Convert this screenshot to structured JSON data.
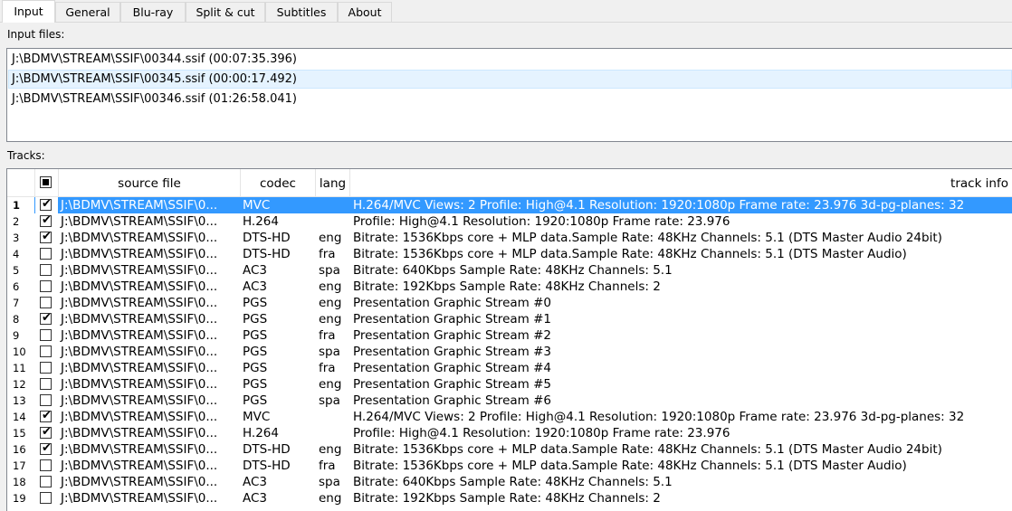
{
  "tabs": [
    {
      "label": "Input",
      "active": true
    },
    {
      "label": "General",
      "active": false
    },
    {
      "label": "Blu-ray",
      "active": false
    },
    {
      "label": "Split & cut",
      "active": false
    },
    {
      "label": "Subtitles",
      "active": false
    },
    {
      "label": "About",
      "active": false
    }
  ],
  "input_files": {
    "label": "Input files:",
    "items": [
      {
        "text": "J:\\BDMV\\STREAM\\SSIF\\00344.ssif (00:07:35.396)",
        "selected": false
      },
      {
        "text": "J:\\BDMV\\STREAM\\SSIF\\00345.ssif (00:00:17.492)",
        "selected": true
      },
      {
        "text": "J:\\BDMV\\STREAM\\SSIF\\00346.ssif (01:26:58.041)",
        "selected": false
      }
    ]
  },
  "tracks": {
    "label": "Tracks:",
    "headers": {
      "source": "source file",
      "codec": "codec",
      "lang": "lang",
      "info": "track info"
    },
    "rows": [
      {
        "num": "1",
        "checked": true,
        "source": "J:\\BDMV\\STREAM\\SSIF\\0...",
        "codec": "MVC",
        "lang": "",
        "info": "H.264/MVC Views: 2 Profile: High@4.1  Resolution: 1920:1080p  Frame rate: 23.976  3d-pg-planes: 32",
        "selected": true
      },
      {
        "num": "2",
        "checked": true,
        "source": "J:\\BDMV\\STREAM\\SSIF\\0...",
        "codec": "H.264",
        "lang": "",
        "info": "Profile: High@4.1  Resolution: 1920:1080p  Frame rate: 23.976",
        "selected": false
      },
      {
        "num": "3",
        "checked": true,
        "source": "J:\\BDMV\\STREAM\\SSIF\\0...",
        "codec": "DTS-HD",
        "lang": "eng",
        "info": "Bitrate: 1536Kbps  core + MLP data.Sample Rate: 48KHz  Channels: 5.1 (DTS Master Audio 24bit)",
        "selected": false
      },
      {
        "num": "4",
        "checked": false,
        "source": "J:\\BDMV\\STREAM\\SSIF\\0...",
        "codec": "DTS-HD",
        "lang": "fra",
        "info": "Bitrate: 1536Kbps  core + MLP data.Sample Rate: 48KHz  Channels: 5.1 (DTS Master Audio)",
        "selected": false
      },
      {
        "num": "5",
        "checked": false,
        "source": "J:\\BDMV\\STREAM\\SSIF\\0...",
        "codec": "AC3",
        "lang": "spa",
        "info": "Bitrate: 640Kbps Sample Rate: 48KHz Channels: 5.1",
        "selected": false
      },
      {
        "num": "6",
        "checked": false,
        "source": "J:\\BDMV\\STREAM\\SSIF\\0...",
        "codec": "AC3",
        "lang": "eng",
        "info": "Bitrate: 192Kbps Sample Rate: 48KHz Channels: 2",
        "selected": false
      },
      {
        "num": "7",
        "checked": false,
        "source": "J:\\BDMV\\STREAM\\SSIF\\0...",
        "codec": "PGS",
        "lang": "eng",
        "info": "Presentation Graphic Stream #0",
        "selected": false
      },
      {
        "num": "8",
        "checked": true,
        "source": "J:\\BDMV\\STREAM\\SSIF\\0...",
        "codec": "PGS",
        "lang": "eng",
        "info": "Presentation Graphic Stream #1",
        "selected": false
      },
      {
        "num": "9",
        "checked": false,
        "source": "J:\\BDMV\\STREAM\\SSIF\\0...",
        "codec": "PGS",
        "lang": "fra",
        "info": "Presentation Graphic Stream #2",
        "selected": false
      },
      {
        "num": "10",
        "checked": false,
        "source": "J:\\BDMV\\STREAM\\SSIF\\0...",
        "codec": "PGS",
        "lang": "spa",
        "info": "Presentation Graphic Stream #3",
        "selected": false
      },
      {
        "num": "11",
        "checked": false,
        "source": "J:\\BDMV\\STREAM\\SSIF\\0...",
        "codec": "PGS",
        "lang": "fra",
        "info": "Presentation Graphic Stream #4",
        "selected": false
      },
      {
        "num": "12",
        "checked": false,
        "source": "J:\\BDMV\\STREAM\\SSIF\\0...",
        "codec": "PGS",
        "lang": "eng",
        "info": "Presentation Graphic Stream #5",
        "selected": false
      },
      {
        "num": "13",
        "checked": false,
        "source": "J:\\BDMV\\STREAM\\SSIF\\0...",
        "codec": "PGS",
        "lang": "spa",
        "info": "Presentation Graphic Stream #6",
        "selected": false
      },
      {
        "num": "14",
        "checked": true,
        "source": "J:\\BDMV\\STREAM\\SSIF\\0...",
        "codec": "MVC",
        "lang": "",
        "info": "H.264/MVC Views: 2 Profile: High@4.1  Resolution: 1920:1080p  Frame rate: 23.976  3d-pg-planes: 32",
        "selected": false
      },
      {
        "num": "15",
        "checked": true,
        "source": "J:\\BDMV\\STREAM\\SSIF\\0...",
        "codec": "H.264",
        "lang": "",
        "info": "Profile: High@4.1  Resolution: 1920:1080p  Frame rate: 23.976",
        "selected": false
      },
      {
        "num": "16",
        "checked": true,
        "source": "J:\\BDMV\\STREAM\\SSIF\\0...",
        "codec": "DTS-HD",
        "lang": "eng",
        "info": "Bitrate: 1536Kbps  core + MLP data.Sample Rate: 48KHz  Channels: 5.1 (DTS Master Audio 24bit)",
        "selected": false
      },
      {
        "num": "17",
        "checked": false,
        "source": "J:\\BDMV\\STREAM\\SSIF\\0...",
        "codec": "DTS-HD",
        "lang": "fra",
        "info": "Bitrate: 1536Kbps  core + MLP data.Sample Rate: 48KHz  Channels: 5.1 (DTS Master Audio)",
        "selected": false
      },
      {
        "num": "18",
        "checked": false,
        "source": "J:\\BDMV\\STREAM\\SSIF\\0...",
        "codec": "AC3",
        "lang": "spa",
        "info": "Bitrate: 640Kbps Sample Rate: 48KHz Channels: 5.1",
        "selected": false
      },
      {
        "num": "19",
        "checked": false,
        "source": "J:\\BDMV\\STREAM\\SSIF\\0...",
        "codec": "AC3",
        "lang": "eng",
        "info": "Bitrate: 192Kbps Sample Rate: 48KHz Channels: 2",
        "selected": false
      }
    ]
  }
}
